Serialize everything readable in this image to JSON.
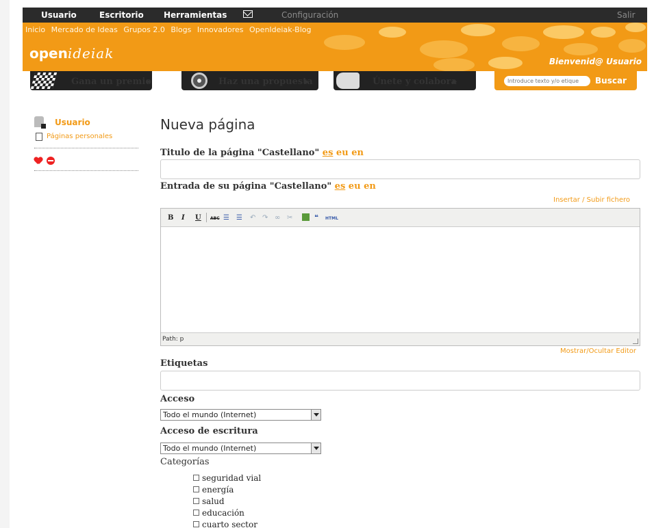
{
  "topbar": {
    "items": [
      "Usuario",
      "Escritorio",
      "Herramientas"
    ],
    "mail_icon": "envelope-icon",
    "config": "Configuración",
    "logout": "Salir"
  },
  "subnav": [
    "Inicio",
    "Mercado de Ideas",
    "Grupos 2.0",
    "Blogs",
    "Innovadores",
    "OpenIdeiak-Blog"
  ],
  "logo": {
    "open": "open",
    "ideiak": "ideiak"
  },
  "welcome": "Bienvenid@ Usuario",
  "actions": [
    "Gana un premio",
    "Haz una propuesta",
    "Únete y colabora"
  ],
  "search": {
    "placeholder": "Introduce texto y/o etique",
    "button": "Buscar"
  },
  "sidebar": {
    "user": "Usuario",
    "pages": "Páginas personales"
  },
  "main": {
    "title": "Nueva página",
    "title_label": "Titulo de la página \"Castellano\"",
    "entry_label": "Entrada de su página \"Castellano\"",
    "langs": [
      "es",
      "eu",
      "en"
    ],
    "insert_link": "Insertar / Subir fichero",
    "editor_toolbar": [
      "B",
      "I",
      "U",
      "ABC",
      "HTML"
    ],
    "editor_path": "Path: p",
    "toggle_editor": "Mostrar/Ocultar Editor",
    "tags_label": "Etiquetas",
    "access_label": "Acceso",
    "access_value": "Todo el mundo (Internet)",
    "write_access_label": "Acceso de escritura",
    "write_access_value": "Todo el mundo (Internet)",
    "categories_label": "Categorías",
    "categories": [
      "seguridad vial",
      "energía",
      "salud",
      "educación",
      "cuarto sector"
    ]
  },
  "colors": {
    "accent": "#f29a16",
    "dark": "#2b2b2b"
  }
}
